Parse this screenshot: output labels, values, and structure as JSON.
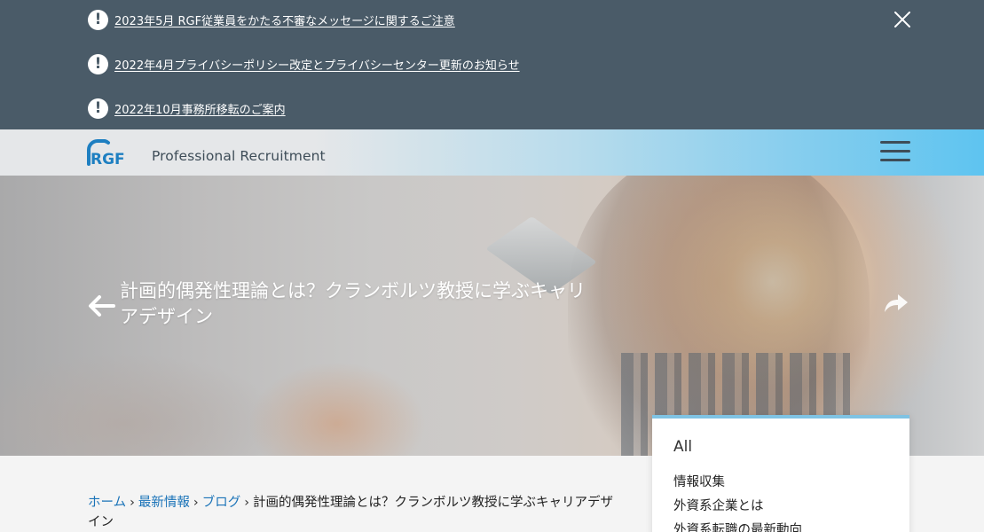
{
  "notices": [
    {
      "icon": "exclamation-circle-icon",
      "text": "2023年5月 RGF従業員をかたる不審なメッセージに関するご注意"
    },
    {
      "icon": "exclamation-circle-icon",
      "text": "2022年4月プライバシーポリシー改定とプライバシーセンター更新のお知らせ"
    },
    {
      "icon": "exclamation-circle-icon",
      "text": "2022年10月事務所移転のご案内"
    }
  ],
  "header": {
    "logo_mark": "RGF",
    "logo_tagline": "Professional Recruitment",
    "menu_icon": "hamburger-menu-icon"
  },
  "hero": {
    "title": "計画的偶発性理論とは？クランボルツ教授に学ぶキャリアデザイン",
    "prev_icon": "arrow-left-icon",
    "next_icon": "share-arrow-icon"
  },
  "breadcrumb": {
    "home": "ホーム",
    "news": "最新情報",
    "blog": "ブログ",
    "current": "計画的偶発性理論とは？クランボルツ教授に学ぶキャリアデザイン",
    "separator": "›"
  },
  "categories": {
    "all_label": "All",
    "items": [
      "情報収集",
      "外資系企業とは",
      "外資系転職の最新動向"
    ]
  },
  "colors": {
    "notice_bg": "#4a5b68",
    "link_blue": "#1a73b8",
    "accent_blue": "#5ec4f0",
    "logo_blue": "#1e7fc1"
  }
}
